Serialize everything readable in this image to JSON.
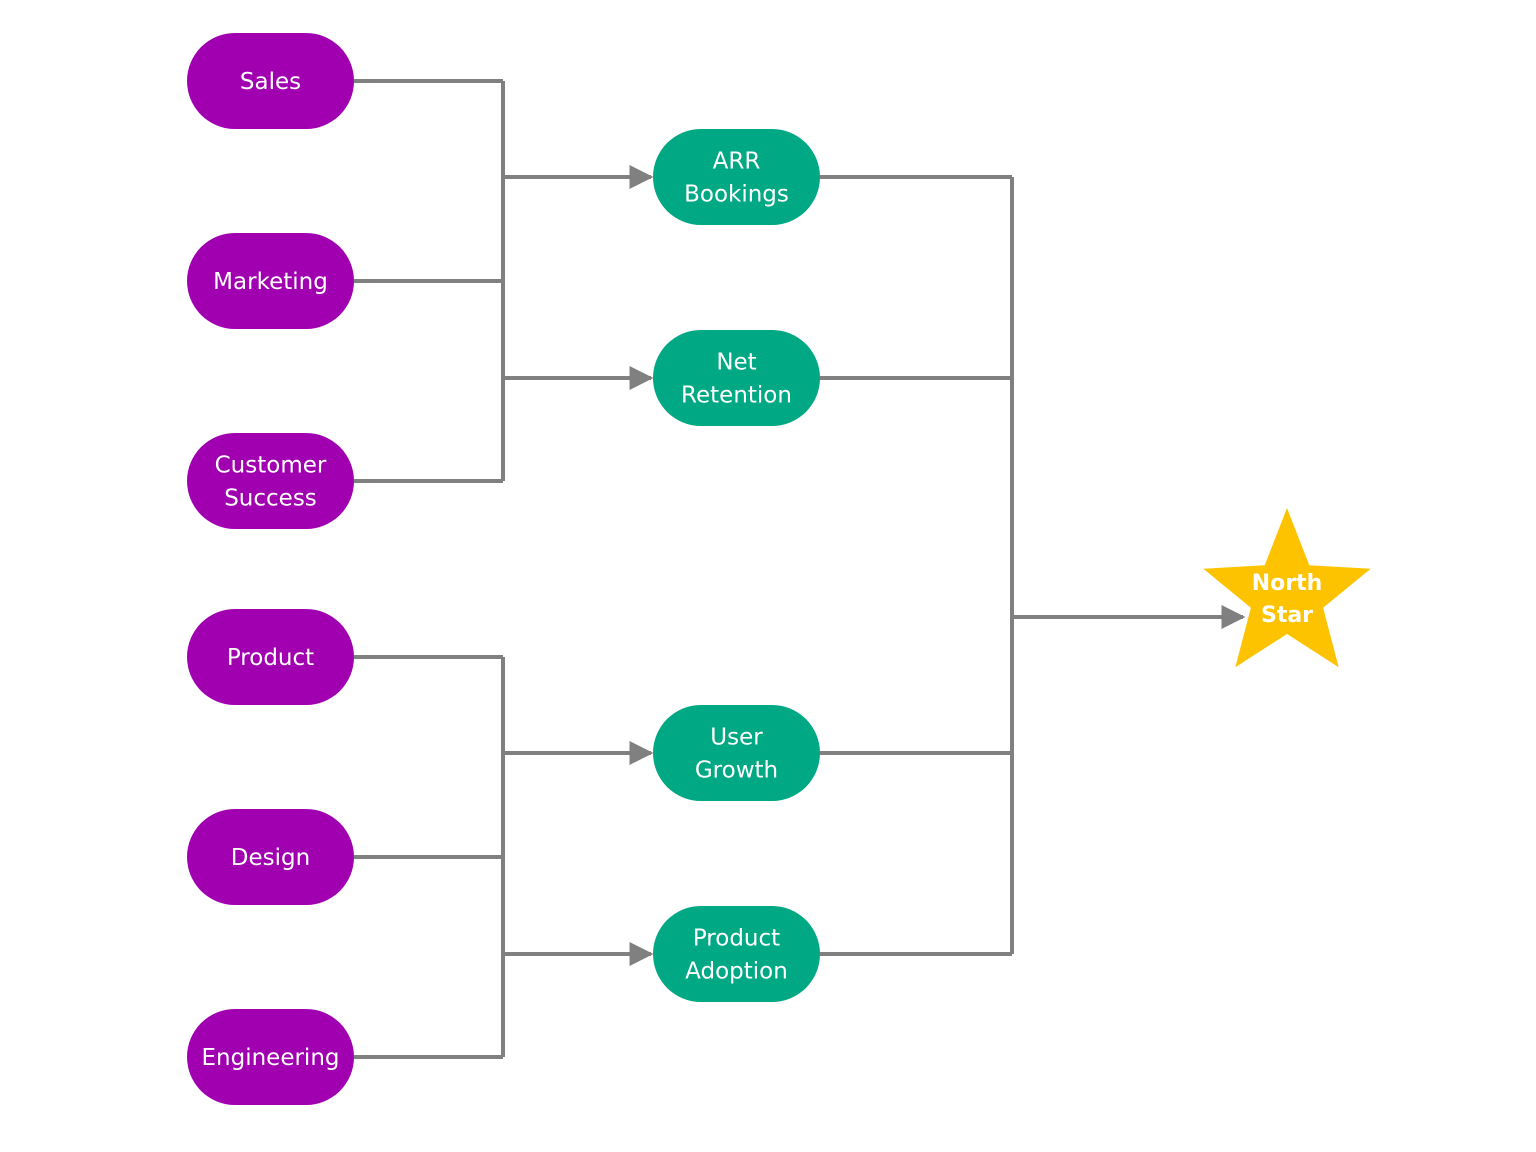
{
  "colors": {
    "team": "#a100b0",
    "metric": "#00a884",
    "north_star": "#fdc300",
    "connector": "#808080"
  },
  "teams": [
    {
      "lines": [
        "Sales"
      ]
    },
    {
      "lines": [
        "Marketing"
      ]
    },
    {
      "lines": [
        "Customer",
        "Success"
      ]
    },
    {
      "lines": [
        "Product"
      ]
    },
    {
      "lines": [
        "Design"
      ]
    },
    {
      "lines": [
        "Engineering"
      ]
    }
  ],
  "metrics": [
    {
      "lines": [
        "ARR",
        "Bookings"
      ]
    },
    {
      "lines": [
        "Net",
        "Retention"
      ]
    },
    {
      "lines": [
        "User",
        "Growth"
      ]
    },
    {
      "lines": [
        "Product",
        "Adoption"
      ]
    }
  ],
  "north_star": {
    "lines": [
      "North",
      "Star"
    ]
  }
}
